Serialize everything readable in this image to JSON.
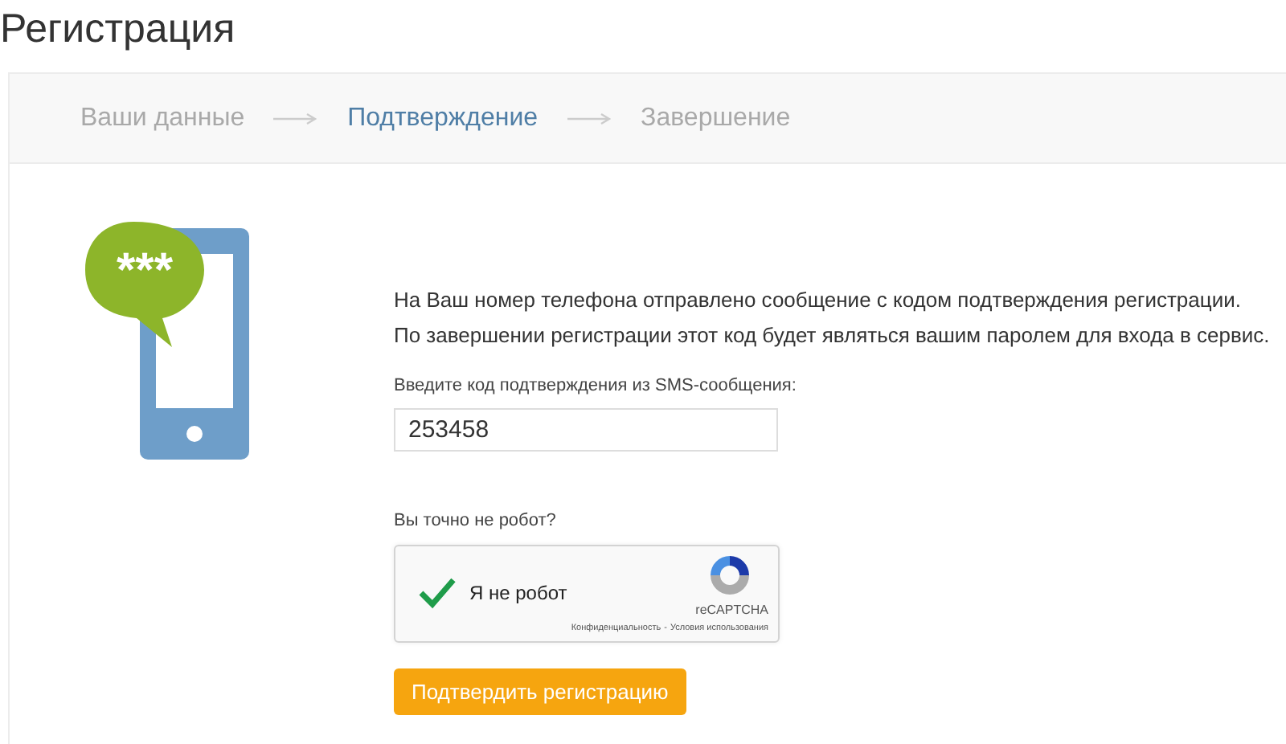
{
  "page_title": "Регистрация",
  "steps": [
    {
      "label": "Ваши данные",
      "selected": false
    },
    {
      "label": "Подтверждение",
      "selected": true
    },
    {
      "label": "Завершение",
      "selected": false
    }
  ],
  "bubble_text": "***",
  "message": [
    "На Ваш номер телефона отправлено сообщение с кодом подтверждения регистрации.",
    "По завершении регистрации этот код будет являться вашим паролем для входа в сервис."
  ],
  "code_field": {
    "label": "Введите код подтверждения из SMS-сообщения:",
    "value": "253458"
  },
  "captcha": {
    "question": "Вы точно не робот?",
    "label": "Я не робот",
    "checked": true,
    "brand": "reCAPTCHA",
    "privacy_link": "Конфиденциальность",
    "separator": "-",
    "terms_link": "Условия использования"
  },
  "submit_button": "Подтвердить регистрацию"
}
